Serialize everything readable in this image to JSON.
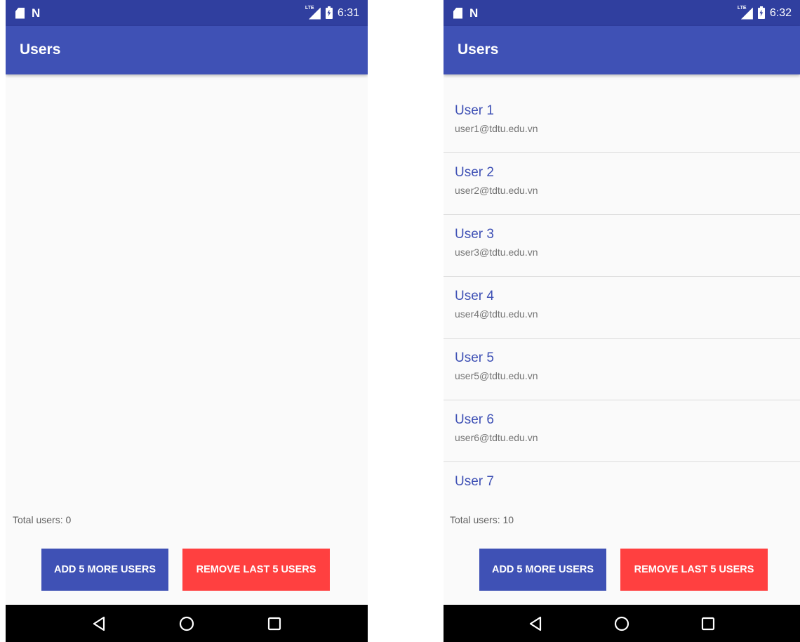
{
  "screens": [
    {
      "status_bar": {
        "time": "6:31",
        "network": "LTE"
      },
      "app_bar": {
        "title": "Users"
      },
      "users": [],
      "total_label": "Total users: 0",
      "buttons": {
        "add": "ADD 5 MORE USERS",
        "remove": "REMOVE LAST 5 USERS"
      }
    },
    {
      "status_bar": {
        "time": "6:32",
        "network": "LTE"
      },
      "app_bar": {
        "title": "Users"
      },
      "users": [
        {
          "name": "User 1",
          "email": "user1@tdtu.edu.vn"
        },
        {
          "name": "User 2",
          "email": "user2@tdtu.edu.vn"
        },
        {
          "name": "User 3",
          "email": "user3@tdtu.edu.vn"
        },
        {
          "name": "User 4",
          "email": "user4@tdtu.edu.vn"
        },
        {
          "name": "User 5",
          "email": "user5@tdtu.edu.vn"
        },
        {
          "name": "User 6",
          "email": "user6@tdtu.edu.vn"
        },
        {
          "name": "User 7",
          "email": ""
        }
      ],
      "total_label": "Total users: 10",
      "buttons": {
        "add": "ADD 5 MORE USERS",
        "remove": "REMOVE LAST 5 USERS"
      }
    }
  ],
  "colors": {
    "status_bar": "#303f9f",
    "app_bar": "#3f51b5",
    "primary": "#3f51b5",
    "remove_button": "#ff4040",
    "nav_bar": "#000000"
  },
  "icons": {
    "status_left": [
      "sd-card-icon",
      "n-notification-icon"
    ],
    "status_right": [
      "lte-signal-icon",
      "battery-charging-icon"
    ],
    "nav": [
      "back-icon",
      "home-icon",
      "recents-icon"
    ]
  }
}
